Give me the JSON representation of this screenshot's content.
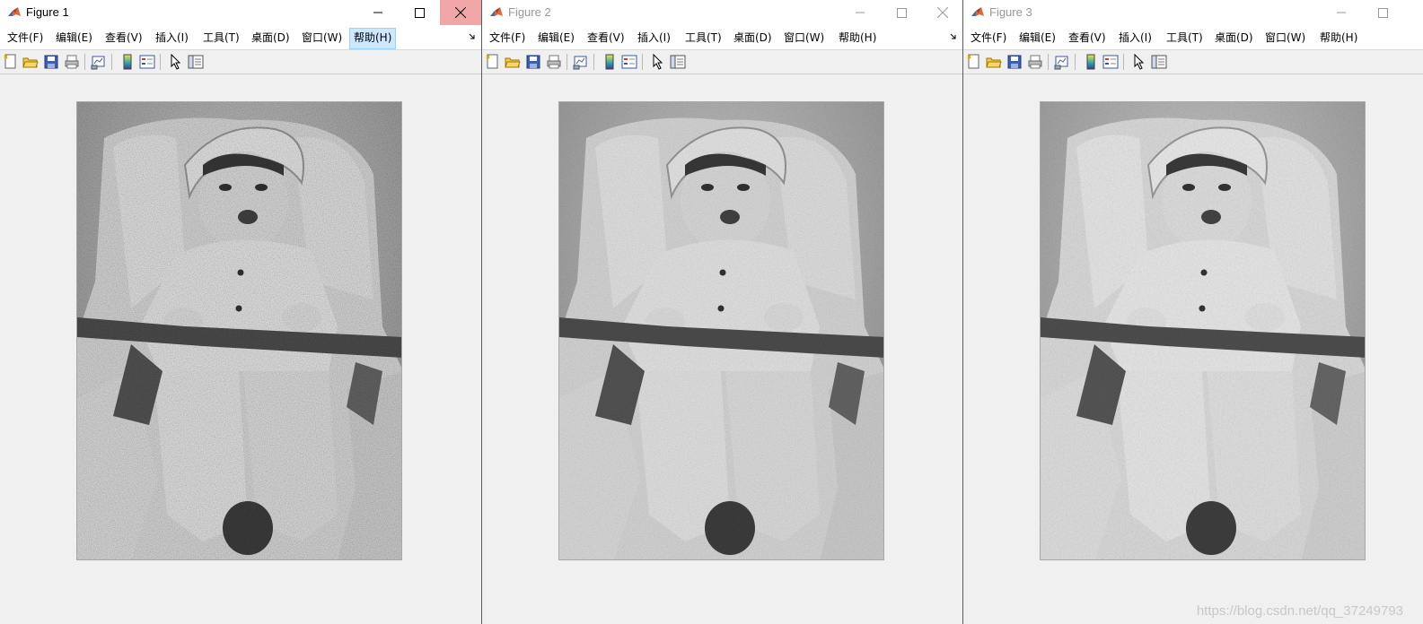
{
  "figures": [
    {
      "title": "Figure 1",
      "active": true
    },
    {
      "title": "Figure 2",
      "active": false
    },
    {
      "title": "Figure 3",
      "active": false
    }
  ],
  "menu": [
    "文件(F)",
    "编辑(E)",
    "查看(V)",
    "插入(I)",
    "工具(T)",
    "桌面(D)",
    "窗口(W)",
    "帮助(H)"
  ],
  "toolbar_icons": [
    "new-figure-icon",
    "open-file-icon",
    "save-icon",
    "print-icon",
    "link-plot-icon",
    "colorbar-icon",
    "legend-icon",
    "pointer-icon",
    "property-inspector-icon"
  ],
  "images": [
    {
      "content": "grayscale baby photo with heavy noise"
    },
    {
      "content": "grayscale baby photo with moderate noise"
    },
    {
      "content": "grayscale baby photo filtered, smoother"
    }
  ],
  "watermark": "https://blog.csdn.net/qq_37249793",
  "colors": {
    "close_active": "#f1a7a7",
    "menu_hover": "#cce8ff",
    "matlab_orange": "#e0663a"
  }
}
